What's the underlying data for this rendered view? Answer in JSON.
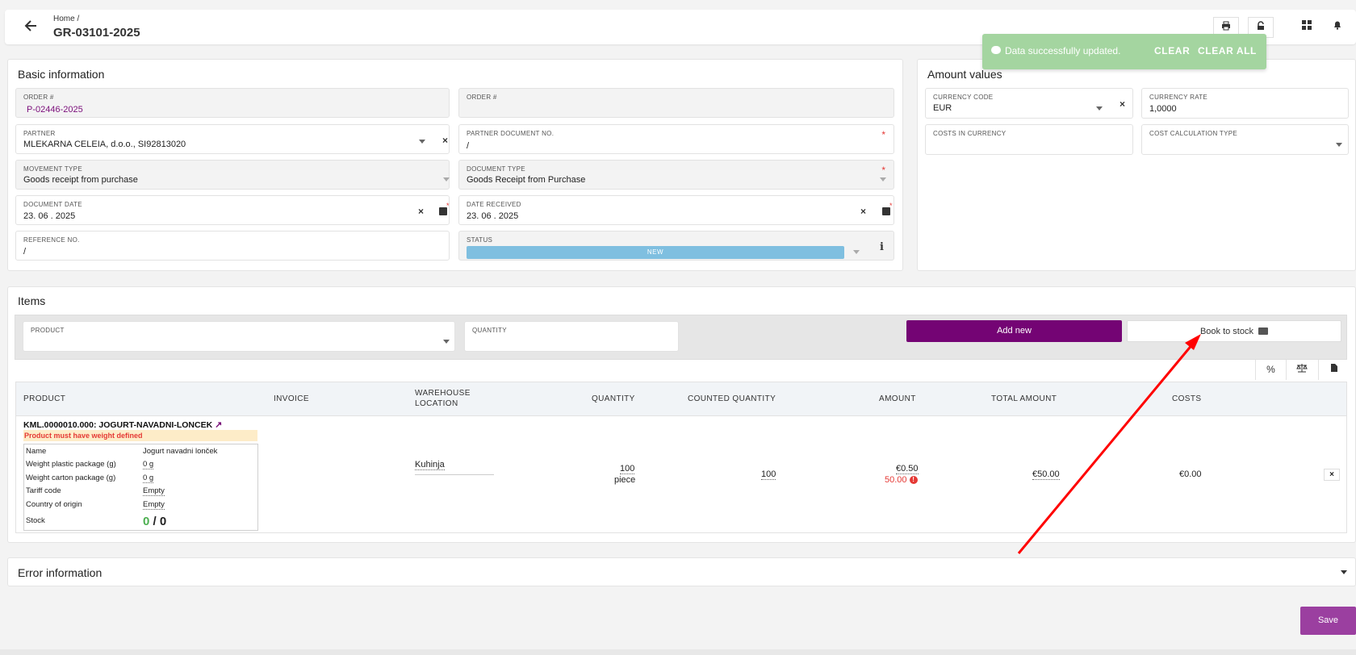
{
  "header": {
    "breadcrumb": "Home  /",
    "title": "GR-03101-2025",
    "back_icon": "arrow-left-icon",
    "actions": [
      "printer-icon",
      "lock-icon",
      "grid-icon",
      "bell-icon"
    ]
  },
  "toast": {
    "message": "Data successfully updated.",
    "clear": "CLEAR",
    "clear_all": "CLEAR ALL",
    "color": "#a4d5a0"
  },
  "basic": {
    "title": "Basic information",
    "order_label": "ORDER #",
    "order_value": "P-02446-2025",
    "order2_label": "ORDER #",
    "partner_label": "PARTNER",
    "partner_value": "MLEKARNA CELEIA, d.o.o., SI92813020",
    "partner_doc_label": "PARTNER DOCUMENT NO.",
    "partner_doc_value": "/",
    "movement_label": "MOVEMENT TYPE",
    "movement_value": "Goods receipt from purchase",
    "doctype_label": "DOCUMENT TYPE",
    "doctype_value": "Goods Receipt from Purchase",
    "docdate_label": "DOCUMENT DATE",
    "docdate_value": "23. 06 . 2025",
    "received_label": "DATE RECEIVED",
    "received_value": "23. 06 . 2025",
    "reference_label": "REFERENCE NO.",
    "reference_value": "/",
    "status_label": "STATUS",
    "status_value": "NEW",
    "status_color": "#7fbfe0"
  },
  "amount": {
    "title": "Amount values",
    "currency_label": "CURRENCY CODE",
    "currency_value": "EUR",
    "rate_label": "CURRENCY RATE",
    "rate_value": "1,0000",
    "costs_label": "COSTS IN CURRENCY",
    "calc_label": "COST CALCULATION TYPE"
  },
  "items": {
    "title": "Items",
    "product_label": "PRODUCT",
    "quantity_label": "QUANTITY",
    "add_new": "Add new",
    "book_to_stock": "Book to stock",
    "tools": [
      "percent-icon",
      "balance-scale-icon",
      "file-icon"
    ],
    "columns": [
      "PRODUCT",
      "INVOICE",
      "WAREHOUSE",
      "LOCATION",
      "QUANTITY",
      "COUNTED QUANTITY",
      "AMOUNT",
      "TOTAL AMOUNT",
      "COSTS"
    ],
    "row": {
      "product": "KML.0000010.000: JOGURT-NAVADNI-LONCEK",
      "warning": "Product must have weight defined",
      "specs": [
        {
          "k": "Name",
          "v": "Jogurt navadni lonček"
        },
        {
          "k": "Weight plastic package (g)",
          "v": "0 g"
        },
        {
          "k": "Weight carton package (g)",
          "v": "0 g"
        },
        {
          "k": "Tariff code",
          "v": "Empty"
        },
        {
          "k": "Country of origin",
          "v": "Empty"
        }
      ],
      "stock_label": "Stock",
      "stock_a": "0",
      "stock_sep": " / ",
      "stock_b": "0",
      "warehouse": "Kuhinja",
      "quantity": "100",
      "unit": "piece",
      "counted": "100",
      "amount": "€0.50",
      "amount_warn": "50.00",
      "total": "€50.00",
      "costs": "€0.00"
    }
  },
  "error_section": {
    "title": "Error information"
  },
  "save": "Save",
  "accent": "#740474"
}
